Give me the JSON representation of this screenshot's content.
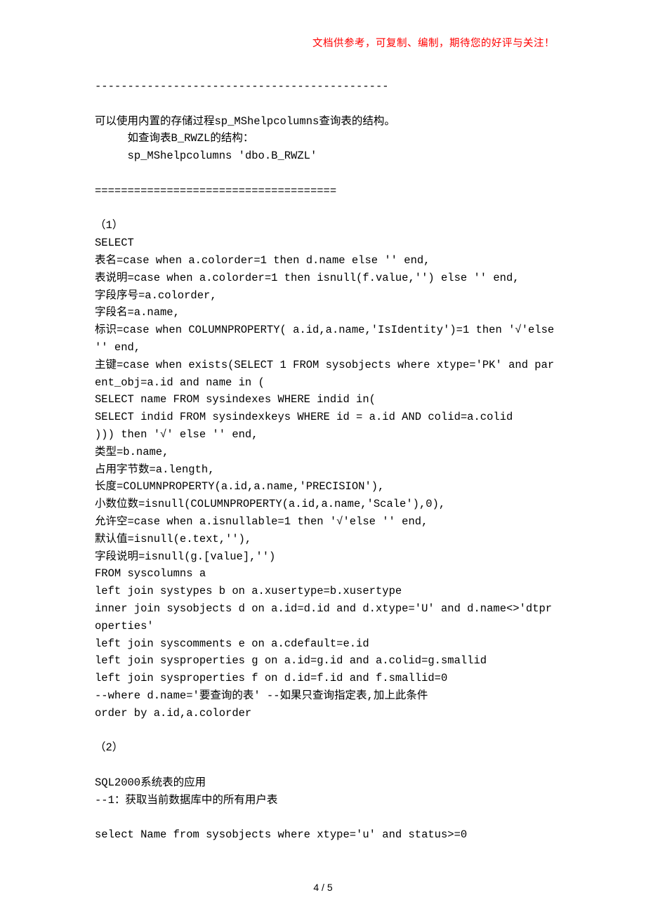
{
  "header": {
    "note": "文档供参考，可复制、编制，期待您的好评与关注！"
  },
  "content": {
    "divider1": "---------------------------------------------",
    "para1a": "可以使用内置的存储过程sp_MShelpcolumns查询表的结构。",
    "para1b": "     如查询表B_RWZL的结构：",
    "para1c": "     sp_MShelpcolumns 'dbo.B_RWZL'",
    "divider2": "=====================================",
    "s1_label": "（1）",
    "s1_01": "SELECT",
    "s1_02": "表名=case when a.colorder=1 then d.name else '' end,",
    "s1_03": "表说明=case when a.colorder=1 then isnull(f.value,'') else '' end,",
    "s1_04": "字段序号=a.colorder,",
    "s1_05": "字段名=a.name,",
    "s1_06": "标识=case when COLUMNPROPERTY( a.id,a.name,'IsIdentity')=1 then '√'else '' end,",
    "s1_07": "主键=case when exists(SELECT 1 FROM sysobjects where xtype='PK' and parent_obj=a.id and name in (",
    "s1_08": "SELECT name FROM sysindexes WHERE indid in(",
    "s1_09": "SELECT indid FROM sysindexkeys WHERE id = a.id AND colid=a.colid",
    "s1_10": "))) then '√' else '' end,",
    "s1_11": "类型=b.name,",
    "s1_12": "占用字节数=a.length,",
    "s1_13": "长度=COLUMNPROPERTY(a.id,a.name,'PRECISION'),",
    "s1_14": "小数位数=isnull(COLUMNPROPERTY(a.id,a.name,'Scale'),0),",
    "s1_15": "允许空=case when a.isnullable=1 then '√'else '' end,",
    "s1_16": "默认值=isnull(e.text,''),",
    "s1_17": "字段说明=isnull(g.[value],'')",
    "s1_18": "FROM syscolumns a",
    "s1_19": "left join systypes b on a.xusertype=b.xusertype",
    "s1_20": "inner join sysobjects d on a.id=d.id and d.xtype='U' and d.name<>'dtproperties'",
    "s1_21": "left join syscomments e on a.cdefault=e.id",
    "s1_22": "left join sysproperties g on a.id=g.id and a.colid=g.smallid",
    "s1_23": "left join sysproperties f on d.id=f.id and f.smallid=0",
    "s1_24": "--where d.name='要查询的表' --如果只查询指定表,加上此条件",
    "s1_25": "order by a.id,a.colorder",
    "s2_label": "（2）",
    "s2_01": "SQL2000系统表的应用",
    "s2_02": "--1：获取当前数据库中的所有用户表",
    "s2_03": "select Name from sysobjects where xtype='u' and status>=0"
  },
  "footer": {
    "page_number": "4 / 5"
  }
}
